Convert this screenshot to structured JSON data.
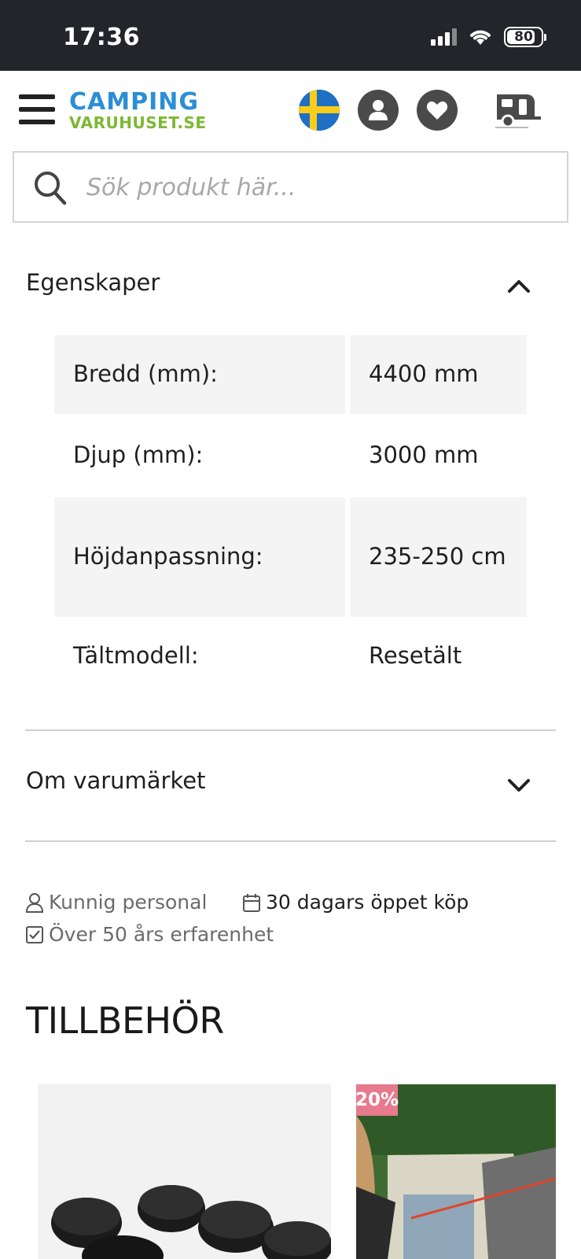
{
  "status_bar": {
    "time": "17:36",
    "battery": "80",
    "battery_level": 0.8
  },
  "header": {
    "logo_top": "CAMPING",
    "logo_bottom": "VARUHUSET.SE",
    "icons": [
      "menu-icon",
      "sweden-flag-icon",
      "user-icon",
      "heart-icon",
      "caravan-cart-icon"
    ]
  },
  "search": {
    "placeholder": "Sök produkt här..."
  },
  "properties": {
    "title": "Egenskaper",
    "rows": [
      {
        "label": "Bredd (mm):",
        "value": "4400 mm"
      },
      {
        "label": "Djup (mm):",
        "value": "3000 mm"
      },
      {
        "label": "Höjdanpassning:",
        "value": "235-250 cm"
      },
      {
        "label": "Tältmodell:",
        "value": "Resetält"
      }
    ]
  },
  "brand_section": {
    "title": "Om varumärket"
  },
  "features": {
    "staff": "Kunnig personal",
    "return": "30 dagars öppet köp",
    "experience": "Över 50 års erfarenhet"
  },
  "accessories": {
    "title": "TILLBEHÖR",
    "cards": [
      {
        "badge": ""
      },
      {
        "badge": "20%"
      }
    ]
  },
  "colors": {
    "status_bar": "#23252a",
    "logo_blue": "#2a8fd6",
    "logo_green": "#7cb832",
    "badge_pink": "#e77a8c",
    "table_shade": "#f4f4f4"
  }
}
